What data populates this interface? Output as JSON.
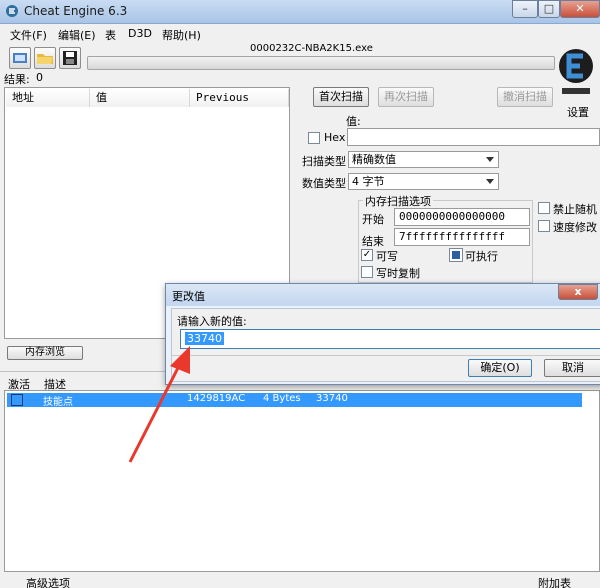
{
  "window": {
    "title": "Cheat Engine 6.3",
    "minimize": "–",
    "maximize": "□",
    "close": "✕"
  },
  "menu": [
    "文件(F)",
    "编辑(E)",
    "表",
    "D3D",
    "帮助(H)"
  ],
  "process_name": "0000232C-NBA2K15.exe",
  "results": {
    "label": "结果:",
    "count": "0"
  },
  "address_list": {
    "columns": [
      "地址",
      "值",
      "Previous"
    ]
  },
  "scan": {
    "first_scan": "首次扫描",
    "next_scan": "再次扫描",
    "undo_scan": "撤消扫描",
    "settings": "设置",
    "value_label": "值:",
    "hex_label": "Hex",
    "scan_type_label": "扫描类型",
    "scan_type_value": "精确数值",
    "value_type_label": "数值类型",
    "value_type_value": "4 字节",
    "memory_options_label": "内存扫描选项",
    "start_label": "开始",
    "start_value": "0000000000000000",
    "end_label": "结束",
    "end_value": "7fffffffffffffff",
    "writable_label": "可写",
    "executable_label": "可执行",
    "copy_on_write_label": "写时复制",
    "disable_random_label": "禁止随机",
    "speedhack_label": "速度修改"
  },
  "memory_view_button": "内存浏览",
  "cheat_table": {
    "columns": [
      "激活",
      "描述"
    ],
    "rows": [
      {
        "description": "技能点",
        "address": "1429819AC",
        "type": "4 Bytes",
        "value": "33740"
      }
    ]
  },
  "dialog": {
    "title": "更改值",
    "close": "x",
    "prompt": "请输入新的值:",
    "input_value": "33740",
    "ok": "确定(O)",
    "cancel": "取消"
  },
  "footer": {
    "advanced": "高级选项",
    "add_table": "附加表"
  },
  "colors": {
    "selection": "#3399ff",
    "arrow": "#e8392c"
  },
  "icons": [
    "cheat-engine-logo-icon",
    "open-process-icon",
    "open-file-icon",
    "save-icon"
  ]
}
